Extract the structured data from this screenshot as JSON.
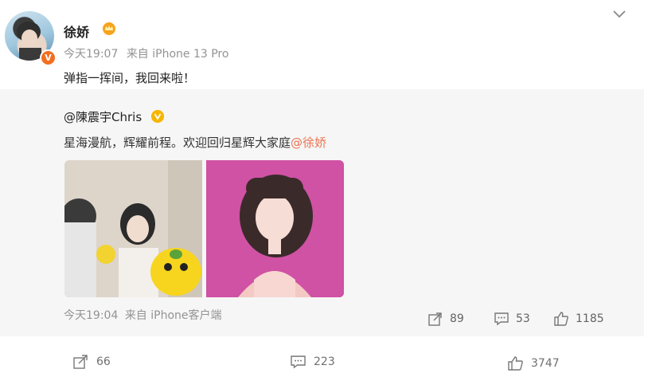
{
  "post": {
    "username": "徐娇",
    "crown_icon": "crown-badge-icon",
    "verified_badge": "V",
    "time": "今天19:07",
    "source": "来自 iPhone 13 Pro",
    "content": "弹指一挥间，我回来啦！",
    "menu_icon": "chevron-down-icon"
  },
  "repost": {
    "author": "@陳震宇Chris",
    "text_main": "星海漫航，辉耀前程。欢迎回归星辉大家庭",
    "mention": "@徐娇",
    "time": "今天19:04",
    "source": "来自 iPhone客户端",
    "stats": {
      "forward": "89",
      "comment": "53",
      "like": "1185"
    }
  },
  "actions": {
    "forward": "66",
    "comment": "223",
    "like": "3747"
  },
  "colors": {
    "accent": "#eb7350",
    "badge_orange": "#f26f21",
    "badge_gold": "#f7b500",
    "repost_bg": "#f6f6f6",
    "meta_gray": "#939393"
  }
}
